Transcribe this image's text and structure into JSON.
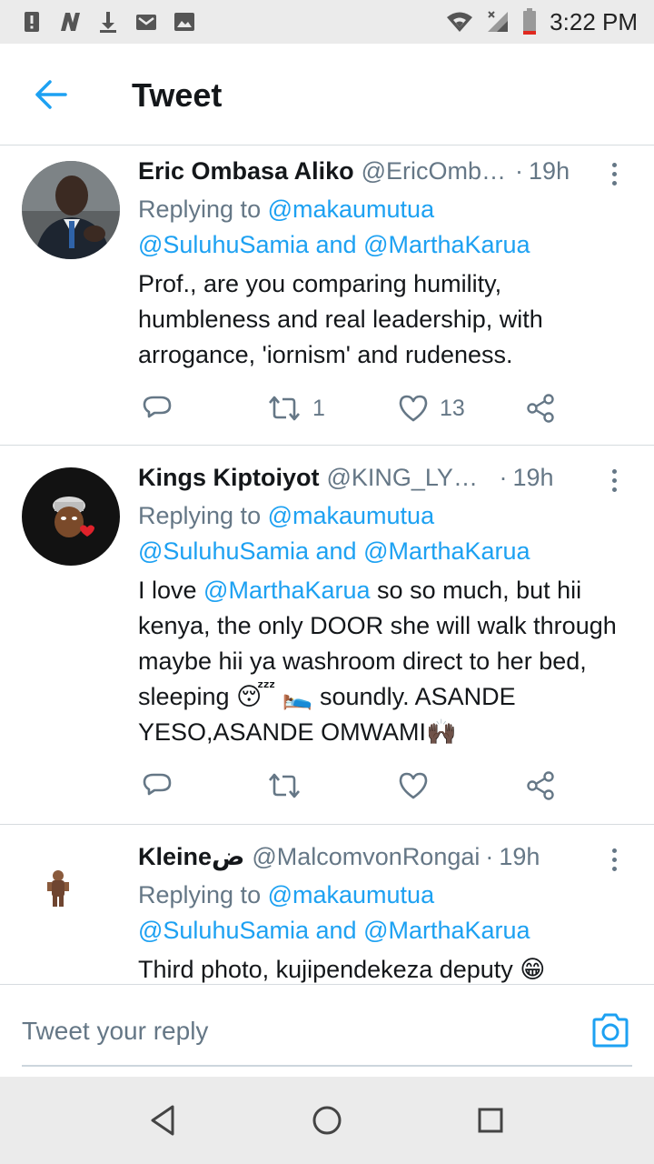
{
  "status_bar": {
    "time": "3:22 PM",
    "left_icons": [
      "alert-icon",
      "n-app-icon",
      "download-icon",
      "gmail-icon",
      "image-icon"
    ],
    "right_icons": [
      "wifi-icon",
      "signal-icon",
      "battery-icon"
    ]
  },
  "header": {
    "back_icon": "arrow-left-icon",
    "title": "Tweet"
  },
  "tweets": [
    {
      "name": "Eric Ombasa Aliko",
      "handle": "@EricOmb…",
      "dot": "·",
      "time": "19h",
      "replying_prefix": "Replying to ",
      "reply_to_1": "@makaumutua",
      "reply_to_2": "@SuluhuSamia",
      "reply_and": " and ",
      "reply_to_3": "@MarthaKarua",
      "text": "Prof., are you comparing humility, humbleness and real leadership, with arrogance, 'iornism' and rudeness.",
      "retweets": "1",
      "likes": "13"
    },
    {
      "name": "Kings Kiptoiyot",
      "handle": "@KING_LYON…",
      "dot": "·",
      "time": "19h",
      "replying_prefix": "Replying to ",
      "reply_to_1": "@makaumutua",
      "reply_to_2": "@SuluhuSamia",
      "reply_and": " and ",
      "reply_to_3": "@MarthaKarua",
      "text_part1": "I love ",
      "text_mention": "@MarthaKarua",
      "text_part2": " so so much, but hii kenya, the only DOOR she will walk through maybe hii ya washroom direct to her bed, sleeping 😴 🛌 soundly. ASANDE YESO,ASANDE OMWAMI🙌🏿",
      "retweets": "",
      "likes": ""
    },
    {
      "name": "Kleineض",
      "handle": "@MalcomvonRongai",
      "dot": "·",
      "time": "19h",
      "replying_prefix": "Replying to ",
      "reply_to_1": "@makaumutua",
      "reply_to_2": "@SuluhuSamia",
      "reply_and": " and ",
      "reply_to_3": "@MarthaKarua",
      "text": "Third photo, kujipendekeza deputy 😁"
    }
  ],
  "reply_bar": {
    "placeholder": "Tweet your reply",
    "camera_icon": "camera-icon"
  },
  "nav": {
    "back": "nav-back-icon",
    "home": "nav-home-icon",
    "recents": "nav-recents-icon"
  },
  "colors": {
    "accent": "#1da1f2",
    "secondary_text": "#657786",
    "divider": "#d6dbdf",
    "system_bar": "#ebebeb"
  }
}
